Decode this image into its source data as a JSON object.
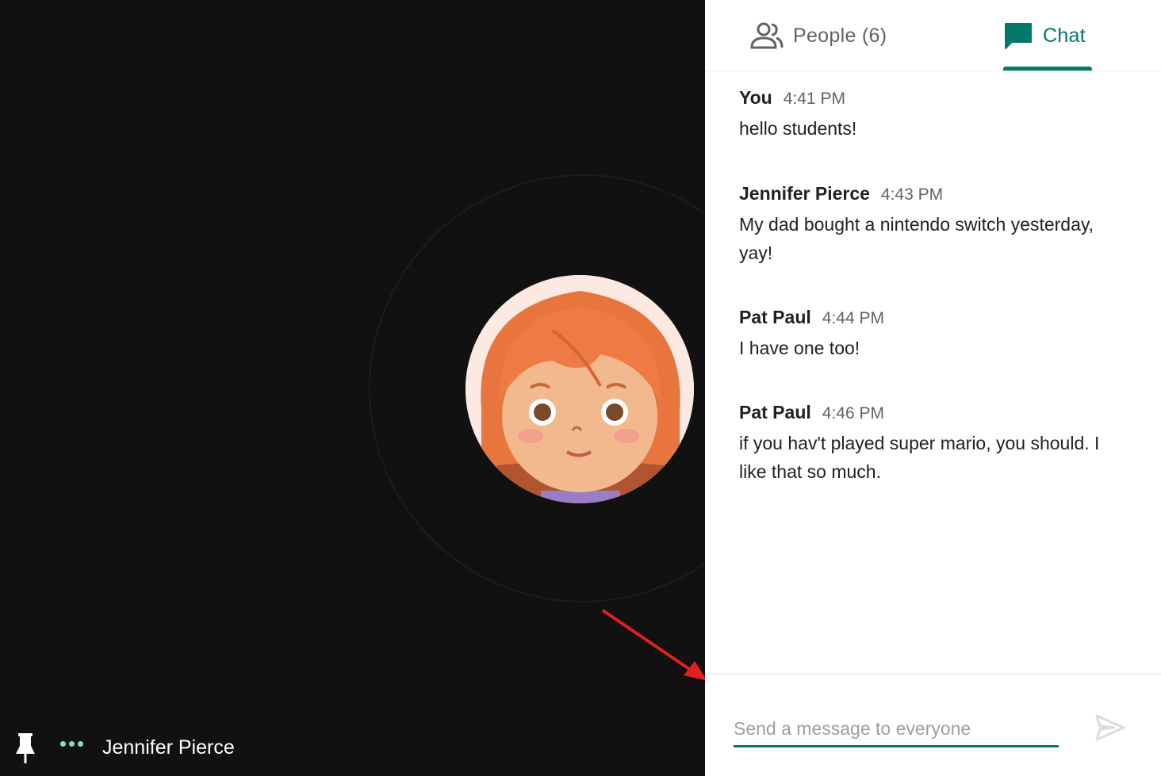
{
  "video": {
    "participant_name": "Jennifer Pierce"
  },
  "panel": {
    "tabs": {
      "people_label": "People (6)",
      "chat_label": "Chat"
    },
    "messages": [
      {
        "author": "You",
        "time": "4:41 PM",
        "text": "hello students!"
      },
      {
        "author": "Jennifer Pierce",
        "time": "4:43 PM",
        "text": "My dad bought a nintendo switch yesterday, yay!"
      },
      {
        "author": "Pat Paul",
        "time": "4:44 PM",
        "text": "I have one too!"
      },
      {
        "author": "Pat Paul",
        "time": "4:46 PM",
        "text": "if you hav't played super mario, you should. I like that so much."
      }
    ],
    "compose": {
      "placeholder": "Send a message to everyone",
      "value": ""
    }
  },
  "colors": {
    "accent": "#00796b",
    "video_bg": "#111111",
    "annotation_arrow": "#e0201c"
  },
  "icons": [
    "people-icon",
    "chat-icon",
    "pin-icon",
    "more-options-icon",
    "send-icon"
  ]
}
